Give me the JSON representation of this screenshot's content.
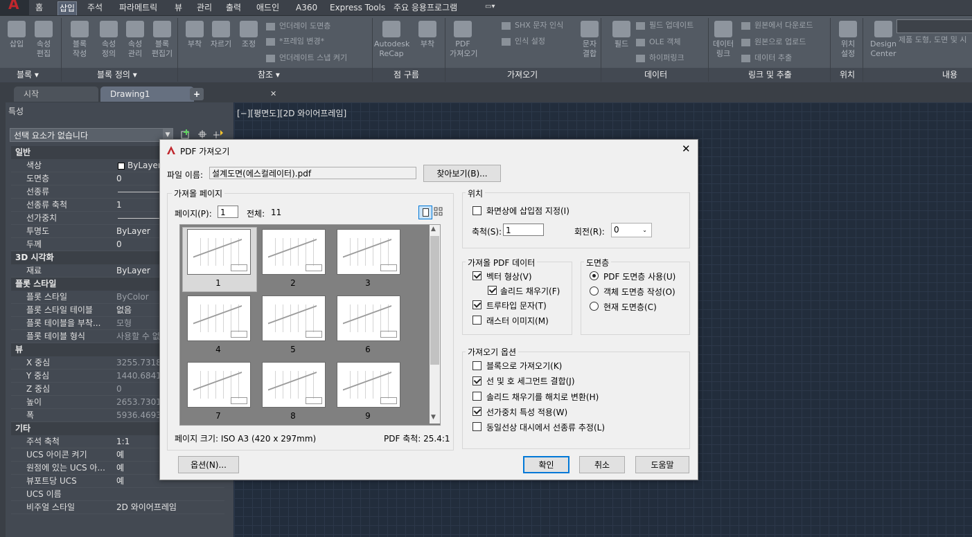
{
  "ribbon_tabs": [
    "홈",
    "삽입",
    "주석",
    "파라메트릭",
    "뷰",
    "관리",
    "출력",
    "애드인",
    "A360",
    "Express Tools",
    "주요 응용프로그램"
  ],
  "active_tab": "삽입",
  "ribbon": {
    "buttons": [
      {
        "label": "삽입"
      },
      {
        "label": "속성\n편집"
      },
      {
        "label": "블록\n작성"
      },
      {
        "label": "속성\n정의"
      },
      {
        "label": "속성\n관리"
      },
      {
        "label": "블록\n편집기"
      },
      {
        "label": "부착"
      },
      {
        "label": "자르기"
      },
      {
        "label": "조정"
      },
      {
        "label": "Autodesk\nReCap"
      },
      {
        "label": "부착"
      },
      {
        "label": "PDF\n가져오기"
      },
      {
        "label": "문자\n결합"
      },
      {
        "label": "필드"
      },
      {
        "label": "데이터\n링크"
      },
      {
        "label": "위치\n설정"
      },
      {
        "label": "Design\nCenter"
      }
    ],
    "small_items": [
      "언더레이 도면층",
      "*프레임 변경*",
      "언더레이트 스냅 켜기",
      "SHX 문자 인식",
      "인식 설정",
      "필드 업데이트",
      "OLE 객체",
      "하이퍼링크",
      "원본에서 다운로드",
      "원본으로 업로드",
      "데이터 추출"
    ],
    "search_hint": "제품 도형, 도면 및 시",
    "footer": [
      "블록 ▾",
      "블록 정의 ▾",
      "참조 ▾",
      "점 구름",
      "가져오기",
      "데이터",
      "링크 및 추출",
      "위치",
      "내용"
    ]
  },
  "file_tabs": {
    "start": "시작",
    "drawing": "Drawing1",
    "close": "✕",
    "add": "+"
  },
  "viewport_label": "[−][평면도][2D 와이어프레임]",
  "properties": {
    "title": "특성",
    "selection": "선택 요소가 없습니다",
    "groups": [
      {
        "name": "일반",
        "rows": [
          {
            "name": "색상",
            "value": "ByLayer"
          },
          {
            "name": "도면층",
            "value": "0"
          },
          {
            "name": "선종류",
            "value": ""
          },
          {
            "name": "선종류 축척",
            "value": "1"
          },
          {
            "name": "선가중치",
            "value": ""
          },
          {
            "name": "투명도",
            "value": "ByLayer"
          },
          {
            "name": "두께",
            "value": "0"
          }
        ]
      },
      {
        "name": "3D 시각화",
        "rows": [
          {
            "name": "재료",
            "value": "ByLayer"
          }
        ]
      },
      {
        "name": "플롯 스타일",
        "rows": [
          {
            "name": "플롯 스타일",
            "value": "ByColor"
          },
          {
            "name": "플롯 스타일 테이블",
            "value": "없음"
          },
          {
            "name": "플롯 테이블을 부착...",
            "value": "모형"
          },
          {
            "name": "플롯 테이블 형식",
            "value": "사용할 수 없"
          }
        ]
      },
      {
        "name": "뷰",
        "rows": [
          {
            "name": "X 중심",
            "value": "3255.7318"
          },
          {
            "name": "Y 중심",
            "value": "1440.6841"
          },
          {
            "name": "Z 중심",
            "value": "0"
          },
          {
            "name": "높이",
            "value": "2653.7301"
          },
          {
            "name": "폭",
            "value": "5936.4693"
          }
        ]
      },
      {
        "name": "기타",
        "rows": [
          {
            "name": "주석 축척",
            "value": "1:1"
          },
          {
            "name": "UCS 아이콘 켜기",
            "value": "예"
          },
          {
            "name": "원점에 있는 UCS 아...",
            "value": "예"
          },
          {
            "name": "뷰포트당 UCS",
            "value": "예"
          },
          {
            "name": "UCS 이름",
            "value": ""
          },
          {
            "name": "비주얼 스타일",
            "value": "2D 와이어프레임"
          }
        ]
      }
    ]
  },
  "dialog": {
    "title": "PDF 가져오기",
    "close": "✕",
    "file_label": "파일 이름:",
    "file_name": "설계도면(에스컬레이터).pdf",
    "browse": "찾아보기(B)...",
    "pages_group": "가져올 페이지",
    "page_label": "페이지(P):",
    "page_value": "1",
    "total_label": "전체:",
    "total_value": "11",
    "thumbnails": [
      "1",
      "2",
      "3",
      "4",
      "5",
      "6",
      "7",
      "8",
      "9"
    ],
    "selected_page": "1",
    "page_size": "페이지 크기: ISO A3 (420 x 297mm)",
    "pdf_scale": "PDF 축척: 25.4:1",
    "position_group": "위치",
    "specify_onscreen": "화면상에 삽입점 지정(I)",
    "scale_label": "축척(S):",
    "scale_value": "1",
    "rotation_label": "회전(R):",
    "rotation_value": "0",
    "data_group": "가져올 PDF 데이터",
    "vector": "벡터 형상(V)",
    "solid_fill": "솔리드 채우기(F)",
    "truetype": "트루타입 문자(T)",
    "raster": "래스터 이미지(M)",
    "layers_group": "도면층",
    "layer_pdf": "PDF 도면층 사용(U)",
    "layer_object": "객체 도면층 작성(O)",
    "layer_current": "현재 도면층(C)",
    "options_group": "가져오기 옵션",
    "as_block": "블록으로 가져오기(K)",
    "join_segments": "선 및 호 세그먼트 결합(J)",
    "fill_to_hatch": "솔리드 채우기를 해치로 변환(H)",
    "apply_lineweight": "선가중치 특성 적용(W)",
    "infer_linetype": "동일선상 대시에서 선종류 추정(L)",
    "options_btn": "옵션(N)...",
    "ok": "확인",
    "cancel": "취소",
    "help": "도움말",
    "checks": {
      "specify_onscreen": false,
      "vector": true,
      "solid_fill": true,
      "truetype": true,
      "raster": false,
      "as_block": false,
      "join_segments": true,
      "fill_to_hatch": false,
      "apply_lineweight": true,
      "infer_linetype": false
    },
    "layer_choice": "pdf"
  }
}
